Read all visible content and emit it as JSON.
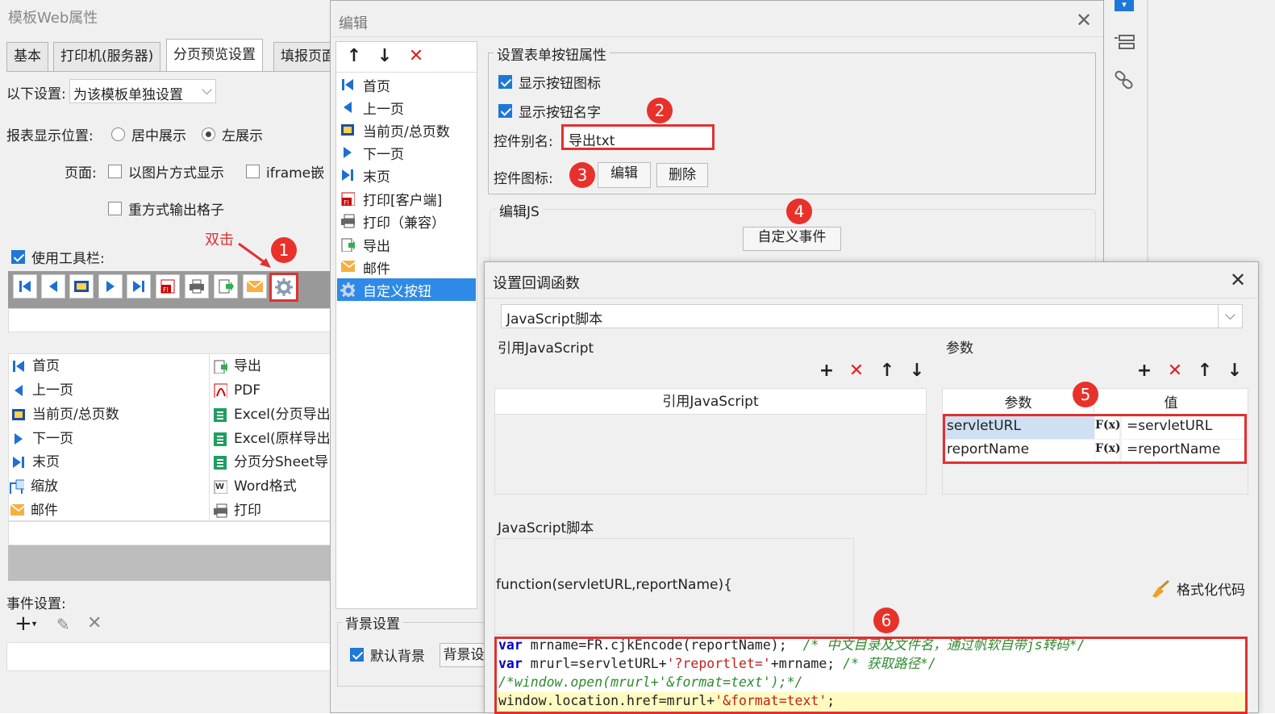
{
  "left": {
    "title": "模板Web属性",
    "tabs": [
      "基本",
      "打印机(服务器)",
      "分页预览设置",
      "填报页面"
    ],
    "settings_label": "以下设置:",
    "settings_value": "为该模板单独设置",
    "position_label": "报表显示位置:",
    "radio_center": "居中展示",
    "radio_left": "左展示",
    "page_label": "页面:",
    "img_mode": "以图片方式显示",
    "iframe": "iframe嵌",
    "output_grid": "重方式输出格子",
    "dblclick": "双击",
    "use_toolbar": "使用工具栏:",
    "list_left": [
      "首页",
      "上一页",
      "当前页/总页数",
      "下一页",
      "末页",
      "缩放",
      "邮件"
    ],
    "list_right": [
      "导出",
      "PDF",
      "Excel(分页导出",
      "Excel(原样导出",
      "分页分Sheet导",
      "Word格式",
      "打印"
    ],
    "event_label": "事件设置:"
  },
  "edit": {
    "title": "编辑",
    "items": [
      "首页",
      "上一页",
      "当前页/总页数",
      "下一页",
      "末页",
      "打印[客户端]",
      "打印（兼容）",
      "导出",
      "邮件",
      "自定义按钮"
    ],
    "bg_group": "背景设置",
    "bg_default": "默认背景",
    "bg_btn": "背景设",
    "group_title": "设置表单按钮属性",
    "show_icon": "显示按钮图标",
    "show_name": "显示按钮名字",
    "alias_label": "控件别名:",
    "alias_value": "导出txt",
    "icon_label": "控件图标:",
    "edit_btn": "编辑",
    "delete_btn": "删除",
    "js_label": "编辑JS",
    "custom_event": "自定义事件"
  },
  "callback": {
    "title": "设置回调函数",
    "type_value": "JavaScript脚本",
    "ref_js_title": "引用JavaScript",
    "ref_js_col": "引用JavaScript",
    "params_title": "参数",
    "param_col": "参数",
    "value_col": "值",
    "params": [
      {
        "name": "servletURL",
        "value": "=servletURL"
      },
      {
        "name": "reportName",
        "value": "=reportName"
      }
    ],
    "fx": "F(x)",
    "script_title": "JavaScript脚本",
    "func_sig": "function(servletURL,reportName){",
    "format_code": "格式化代码",
    "code": {
      "l1_kw": "var",
      "l1": " mrname=FR.cjkEncode(reportName);  ",
      "l1_cm": "/* 中文目录及文件名，通过帆软自带js转码*/",
      "l2_kw": "var",
      "l2a": " mrurl=servletURL+",
      "l2_str": "'?reportlet='",
      "l2b": "+mrname; ",
      "l2_cm": "/* 获取路径*/",
      "l3_cm": "/*window.open(mrurl+'&format=text');*/",
      "l4a": "window.location.href=mrurl+",
      "l4_str": "'&format=text'",
      "l4b": ";"
    }
  },
  "badges": [
    "1",
    "2",
    "3",
    "4",
    "5",
    "6"
  ],
  "colors": {
    "accent": "#2e8ae6",
    "highlight": "#e03030",
    "badge": "#e8312a"
  }
}
